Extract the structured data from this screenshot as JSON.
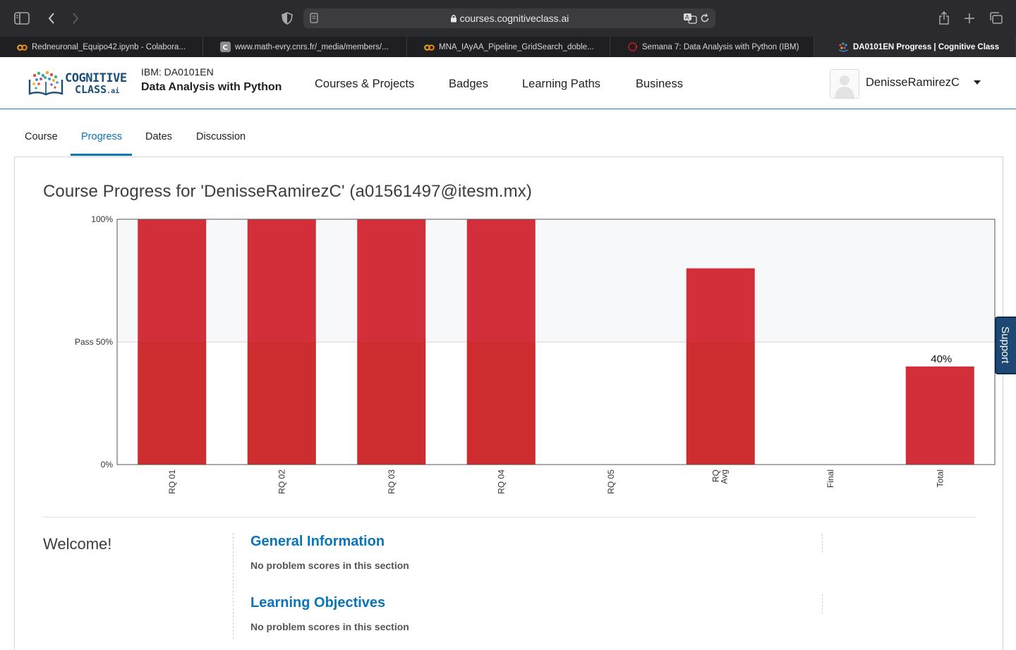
{
  "browser": {
    "url": "courses.cognitiveclass.ai",
    "tabs": [
      {
        "title": "Redneuronal_Equipo42.ipynb - Colabora...",
        "icon": "colab-icon"
      },
      {
        "title": "www.math-evry.cnrs.fr/_media/members/...",
        "icon": "c-letter-icon"
      },
      {
        "title": "MNA_IAyAA_Pipeline_GridSearch_doble...",
        "icon": "colab-icon"
      },
      {
        "title": "Semana 7: Data Analysis with Python (IBM)",
        "icon": "ring-icon"
      },
      {
        "title": "DA0101EN Progress | Cognitive Class",
        "icon": "cognitive-class-icon",
        "active": true
      }
    ]
  },
  "header": {
    "logo_line1": "COGNITIVE",
    "logo_line2": "CLASS",
    "logo_suffix": ".ai",
    "course_org": "IBM: DA0101EN",
    "course_name": "Data Analysis with Python",
    "nav": [
      "Courses & Projects",
      "Badges",
      "Learning Paths",
      "Business"
    ],
    "username": "DenisseRamirezC"
  },
  "course_tabs": [
    "Course",
    "Progress",
    "Dates",
    "Discussion"
  ],
  "active_tab": "Progress",
  "progress_title": "Course Progress for 'DenisseRamirezC' (a01561497@itesm.mx)",
  "chart_data": {
    "type": "bar",
    "categories": [
      "RQ 01",
      "RQ 02",
      "RQ 03",
      "RQ 04",
      "RQ 05",
      "RQ Avg",
      "Final",
      "Total"
    ],
    "values": [
      100,
      100,
      100,
      100,
      0,
      80,
      0,
      40
    ],
    "y_ticks": [
      "100%",
      "Pass 50%",
      "0%"
    ],
    "ylim": [
      0,
      100
    ],
    "pass_threshold": 50,
    "data_labels": {
      "Total": "40%"
    },
    "bar_color": "#d22f3a",
    "grid": false
  },
  "welcome": "Welcome!",
  "sections": [
    {
      "title": "General Information",
      "note": "No problem scores in this section"
    },
    {
      "title": "Learning Objectives",
      "note": "No problem scores in this section"
    }
  ],
  "support_label": "Support",
  "colors": {
    "accent": "#0a74b7",
    "bar": "#d22f3a",
    "support": "#1d4874"
  }
}
